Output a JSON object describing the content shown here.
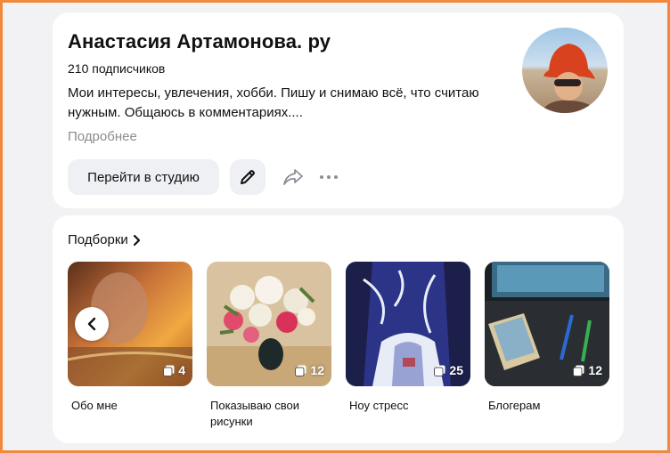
{
  "profile": {
    "title": "Анастасия Артамонова. ру",
    "subscribers": "210 подписчиков",
    "description": "Мои интересы, увлечения, хобби. Пишу и снимаю всё, что считаю нужным. Общаюсь в комментариях....",
    "more_link": "Подробнее",
    "studio_button": "Перейти в студию",
    "avatar_icon": "avatar-photo",
    "edit_icon": "pencil-icon",
    "share_icon": "share-arrow-icon",
    "more_icon": "more-dots-icon"
  },
  "collections": {
    "title": "Подборки",
    "items": [
      {
        "label": "Обо мне",
        "count": "4"
      },
      {
        "label": "Показываю свои рисунки",
        "count": "12"
      },
      {
        "label": "Ноу стресс",
        "count": "25"
      },
      {
        "label": "Блогерам",
        "count": "12"
      }
    ]
  },
  "colors": {
    "frame_border": "#f0893c",
    "page_bg": "#f2f2f4",
    "button_bg": "#eef0f3",
    "muted_text": "#8c8c8c"
  }
}
